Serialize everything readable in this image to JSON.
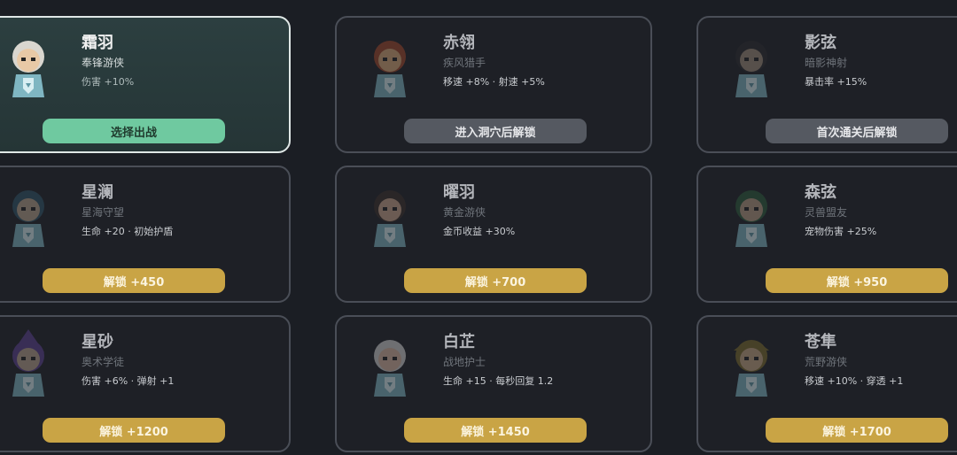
{
  "top_hint": "· · · · · · · · · · · · · · · · · ·",
  "colors": {
    "background": "#1b1e24",
    "selected_border": "#dfe7e6",
    "select_button": "#6fc9a0",
    "locked_button": "#555961",
    "unlock_button": "#c9a445"
  },
  "heroes": [
    {
      "name": "霜羽",
      "role": "奉锋游侠",
      "stat": "伤害 +10%",
      "button": "选择出战",
      "button_type": "select",
      "state": "selected",
      "avatar_icon": "hero-white-hair-icon",
      "hair": "#d9d6cf",
      "skin": "#e8c9a6"
    },
    {
      "name": "赤翎",
      "role": "疾风猎手",
      "stat": "移速 +8% · 射速 +5%",
      "button": "进入洞穴后解锁",
      "button_type": "locked",
      "state": "locked",
      "avatar_icon": "hero-red-hair-icon",
      "hair": "#a0472a",
      "skin": "#d9a877"
    },
    {
      "name": "影弦",
      "role": "暗影神射",
      "stat": "暴击率 +15%",
      "button": "首次通关后解锁",
      "button_type": "locked",
      "state": "locked",
      "avatar_icon": "hero-dark-hood-icon",
      "hair": "#2a2a2e",
      "skin": "#9c8a78"
    },
    {
      "name": "星澜",
      "role": "星海守望",
      "stat": "生命 +20 · 初始护盾",
      "button": "解锁 +450",
      "button_type": "unlock",
      "state": "locked",
      "avatar_icon": "hero-blue-spiky-icon",
      "hair": "#2f5366",
      "skin": "#b5a18a"
    },
    {
      "name": "曜羽",
      "role": "黄金游侠",
      "stat": "金币收益 +30%",
      "button": "解锁 +700",
      "button_type": "unlock",
      "state": "locked",
      "avatar_icon": "hero-red-plume-icon",
      "hair": "#3a2e2a",
      "skin": "#c8a38a"
    },
    {
      "name": "森弦",
      "role": "灵兽盟友",
      "stat": "宠物伤害 +25%",
      "button": "解锁 +950",
      "button_type": "unlock",
      "state": "locked",
      "avatar_icon": "hero-green-elf-icon",
      "hair": "#2c5a3a",
      "skin": "#b59a82"
    },
    {
      "name": "星砂",
      "role": "奥术学徒",
      "stat": "伤害 +6% · 弹射 +1",
      "button": "解锁 +1200",
      "button_type": "unlock",
      "state": "locked",
      "avatar_icon": "hero-wizard-hat-icon",
      "hair": "#5a3f8f",
      "skin": "#b7a08c"
    },
    {
      "name": "白芷",
      "role": "战地护士",
      "stat": "生命 +15 · 每秒回复 1.2",
      "button": "解锁 +1450",
      "button_type": "unlock",
      "state": "locked",
      "avatar_icon": "hero-nurse-cap-icon",
      "hair": "#cfcfcf",
      "skin": "#d8b6a0"
    },
    {
      "name": "苍隼",
      "role": "荒野游侠",
      "stat": "移速 +10% · 穿透 +1",
      "button": "解锁 +1700",
      "button_type": "unlock",
      "state": "locked",
      "avatar_icon": "hero-ranger-hat-icon",
      "hair": "#7a6a2c",
      "skin": "#c4a682"
    }
  ]
}
